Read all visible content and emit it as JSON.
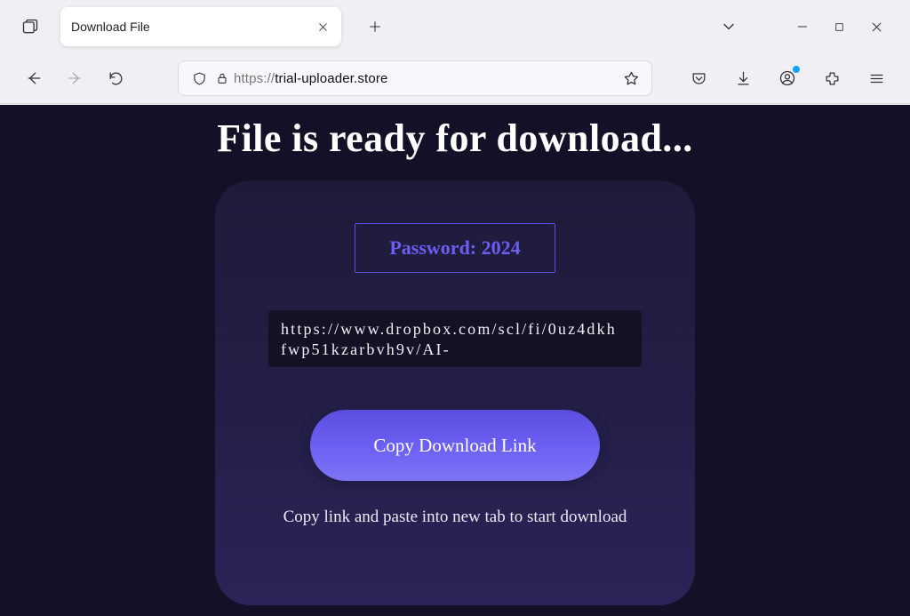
{
  "browser": {
    "tab_title": "Download File",
    "url_prefix": "https://",
    "url_domain": "trial-uploader.store"
  },
  "page": {
    "headline": "File is ready for download...",
    "password_label": "Password: 2024",
    "download_link": "https://www.dropbox.com/scl/fi/0uz4dkhfwp51kzarbvh9v/AI-",
    "copy_button": "Copy Download Link",
    "hint": "Copy link and paste into new tab to start download"
  }
}
